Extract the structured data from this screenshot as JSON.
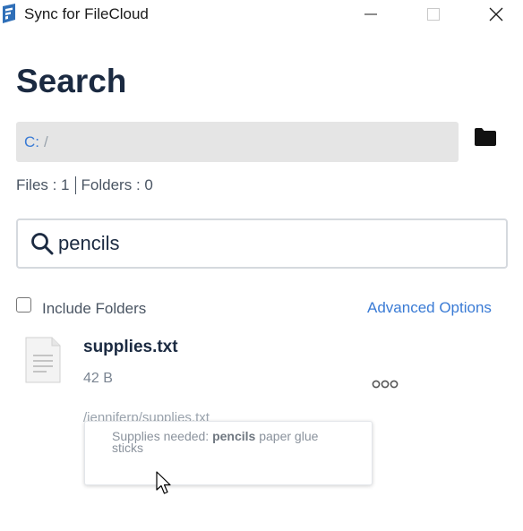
{
  "window": {
    "title": "Sync for FileCloud",
    "minimize_icon": "minimize-icon",
    "maximize_icon": "maximize-icon",
    "close_icon": "close-icon"
  },
  "page": {
    "title": "Search"
  },
  "path": {
    "drive": "C:",
    "separator": "/",
    "folder_icon": "folder-icon"
  },
  "counts": {
    "files": "Files : 1",
    "folders": "Folders : 0"
  },
  "search": {
    "icon": "search-icon",
    "value": "pencils",
    "placeholder": ""
  },
  "options": {
    "include_folders_label": "Include Folders",
    "include_folders_checked": false,
    "advanced_label": "Advanced Options"
  },
  "results": [
    {
      "name": "supplies.txt",
      "size": "42 B",
      "path": "/jenniferp/supplies.txt",
      "icon": "text-file-icon",
      "more_icon": "more-options-icon",
      "snippet_before": "Supplies needed: ",
      "snippet_match": "pencils",
      "snippet_after": " paper glue sticks"
    }
  ],
  "colors": {
    "accent": "#3a7bd5",
    "heading": "#1b2a41",
    "path_bg": "#e5e5e5"
  }
}
